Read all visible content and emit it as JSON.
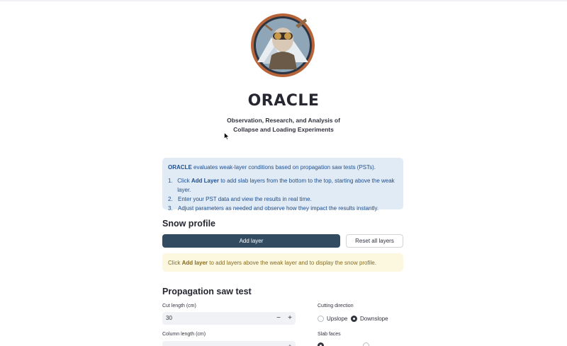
{
  "app": {
    "title": "ORACLE",
    "subtitle_line1": "Observation, Research, and Analysis of",
    "subtitle_line2": "Collapse and Loading Experiments"
  },
  "info": {
    "brand": "ORACLE",
    "intro_rest": " evaluates weak-layer conditions based on propagation saw tests (PSTs).",
    "steps": [
      {
        "num": "1.",
        "pre": "Click ",
        "bold": "Add Layer",
        "post": " to add slab layers from the bottom to the top, starting above the weak layer."
      },
      {
        "num": "2.",
        "pre": "Enter your PST data and view the results in real time.",
        "bold": "",
        "post": ""
      },
      {
        "num": "3.",
        "pre": "Adjust parameters as needed and observe how they impact the results instantly.",
        "bold": "",
        "post": ""
      }
    ]
  },
  "snow_profile": {
    "heading": "Snow profile",
    "add_layer_label": "Add layer",
    "reset_label": "Reset all layers",
    "warning_pre": "Click ",
    "warning_bold": "Add layer",
    "warning_post": " to add layers above the weak layer and to display the snow profile."
  },
  "pst": {
    "heading": "Propagation saw test",
    "cut_length_label": "Cut length (cm)",
    "cut_length_value": "30",
    "column_length_label": "Column length (cm)",
    "cutting_direction_label": "Cutting direction",
    "direction_options": [
      "Upslope",
      "Downslope"
    ],
    "direction_selected": "Downslope",
    "slab_faces_label": "Slab faces"
  },
  "colors": {
    "primary_button": "#324b61",
    "info_bg": "#e1ebf6",
    "info_text": "#1f4e8c",
    "warn_bg": "#fcf8e0",
    "warn_text": "#856a1e"
  },
  "icons": {
    "logo": "oracle-explorer-portrait-logo",
    "cursor": "mouse-pointer-icon",
    "decrement": "minus-icon",
    "increment": "plus-icon"
  }
}
